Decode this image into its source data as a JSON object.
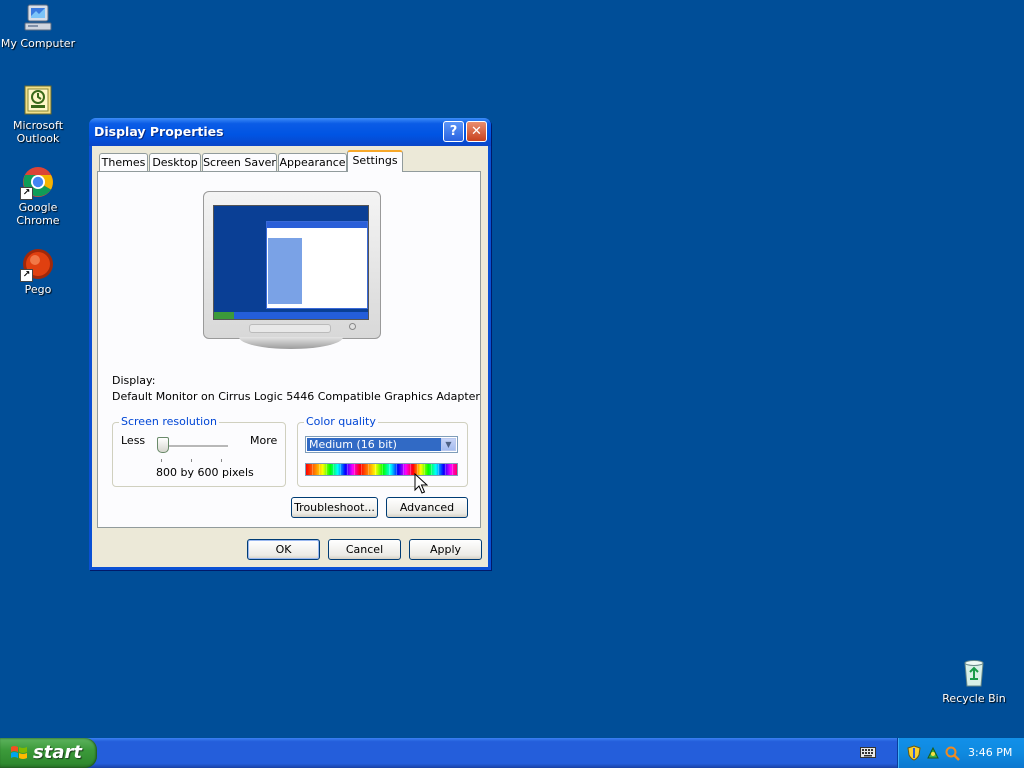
{
  "desktop": {
    "icons": [
      {
        "label": "My Computer"
      },
      {
        "label": "Microsoft Outlook"
      },
      {
        "label": "Google Chrome"
      },
      {
        "label": "Pego"
      },
      {
        "label": "Recycle Bin"
      }
    ]
  },
  "dialog": {
    "title": "Display Properties",
    "help_button": "?",
    "close_button": "✕",
    "tabs": [
      {
        "label": "Themes"
      },
      {
        "label": "Desktop"
      },
      {
        "label": "Screen Saver"
      },
      {
        "label": "Appearance"
      },
      {
        "label": "Settings",
        "active": true
      }
    ],
    "display_label": "Display:",
    "display_value": "Default Monitor on Cirrus Logic 5446 Compatible Graphics Adapter",
    "resolution": {
      "legend": "Screen resolution",
      "less": "Less",
      "more": "More",
      "value": "800 by 600 pixels"
    },
    "color_quality": {
      "legend": "Color quality",
      "selected": "Medium (16 bit)"
    },
    "buttons": {
      "troubleshoot": "Troubleshoot...",
      "advanced": "Advanced",
      "ok": "OK",
      "cancel": "Cancel",
      "apply": "Apply"
    }
  },
  "taskbar": {
    "start_label": "start",
    "clock": "3:46 PM"
  }
}
